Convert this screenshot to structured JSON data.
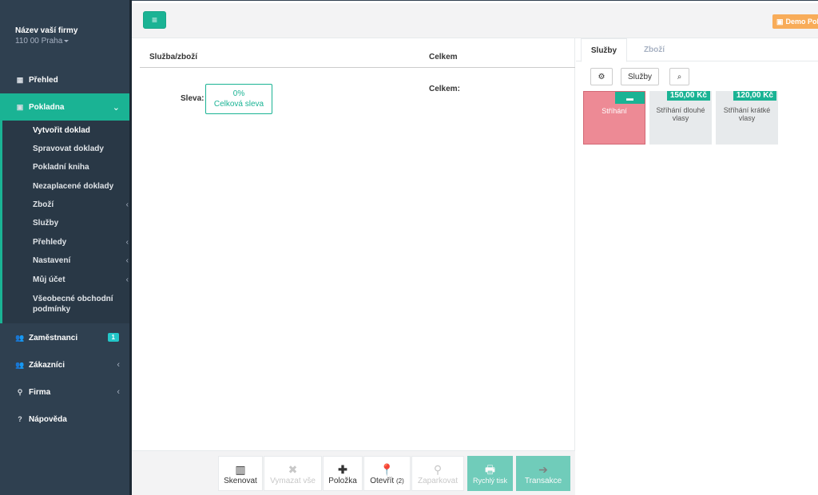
{
  "sidebar": {
    "company_name": "Název vaší firmy",
    "company_location": "110 00 Praha",
    "nav": {
      "prehled": "Přehled",
      "pokladna": "Pokladna",
      "zamestnanci": "Zaměstnanci",
      "zamestnanci_badge": "1",
      "zakaznici": "Zákazníci",
      "firma": "Firma",
      "napoveda": "Nápověda"
    },
    "submenu": [
      "Vytvořit doklad",
      "Spravovat doklady",
      "Pokladní kniha",
      "Nezaplacené doklady",
      "Zboží",
      "Služby",
      "Přehledy",
      "Nastavení",
      "Můj účet",
      "Všeobecné obchodní podmínky"
    ]
  },
  "topbar": {
    "menu_icon": "hamburger-icon",
    "demo_label": "Demo Pokladna"
  },
  "main": {
    "col_item": "Služba/zboží",
    "col_total": "Celkem",
    "discount_label": "Sleva:",
    "discount_value": "0%",
    "discount_caption": "Celková sleva",
    "total_label": "Celkem:"
  },
  "toolbar": {
    "scan": "Skenovat",
    "clear_all": "Vymazat vše",
    "item": "Položka",
    "open": "Otevřít",
    "open_count": "(2)",
    "park": "Zaparkovat",
    "quick_print": "Rychlý tisk",
    "transaction": "Transakce"
  },
  "right": {
    "tab_services": "Služby",
    "tab_goods": "Zboží",
    "filter_label": "Služby",
    "tiles": [
      {
        "name": "Stříhání",
        "type": "folder"
      },
      {
        "name": "Stříhání dlouhé vlasy",
        "price": "150,00 Kč"
      },
      {
        "name": "Stříhání krátké vlasy",
        "price": "120,00 Kč"
      }
    ]
  },
  "colors": {
    "accent": "#1ab394",
    "sidebar": "#2f4050",
    "folder_tile": "#ed8a95",
    "demo": "#f8ac59"
  }
}
